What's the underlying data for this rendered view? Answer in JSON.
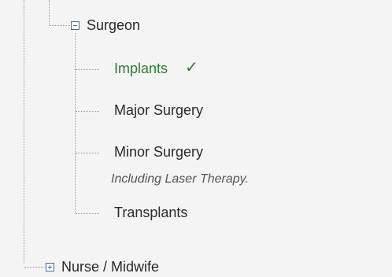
{
  "tree": {
    "surgeon": {
      "label": "Surgeon",
      "expanded": true,
      "children": [
        {
          "label": "Implants",
          "selected": true
        },
        {
          "label": "Major Surgery"
        },
        {
          "label": "Minor Surgery",
          "note": "Including Laser Therapy."
        },
        {
          "label": "Transplants"
        }
      ]
    },
    "nurse": {
      "label": "Nurse / Midwife",
      "expanded": false
    }
  },
  "icons": {
    "expanded_toggle": "minus-box-icon",
    "collapsed_toggle": "plus-box-icon",
    "selected_marker": "checkmark-icon"
  },
  "colors": {
    "selected_text": "#2e7d32",
    "toggle_border": "#3b6ea8",
    "panel_background": "#f4f4f4"
  },
  "check_glyph": "✓"
}
